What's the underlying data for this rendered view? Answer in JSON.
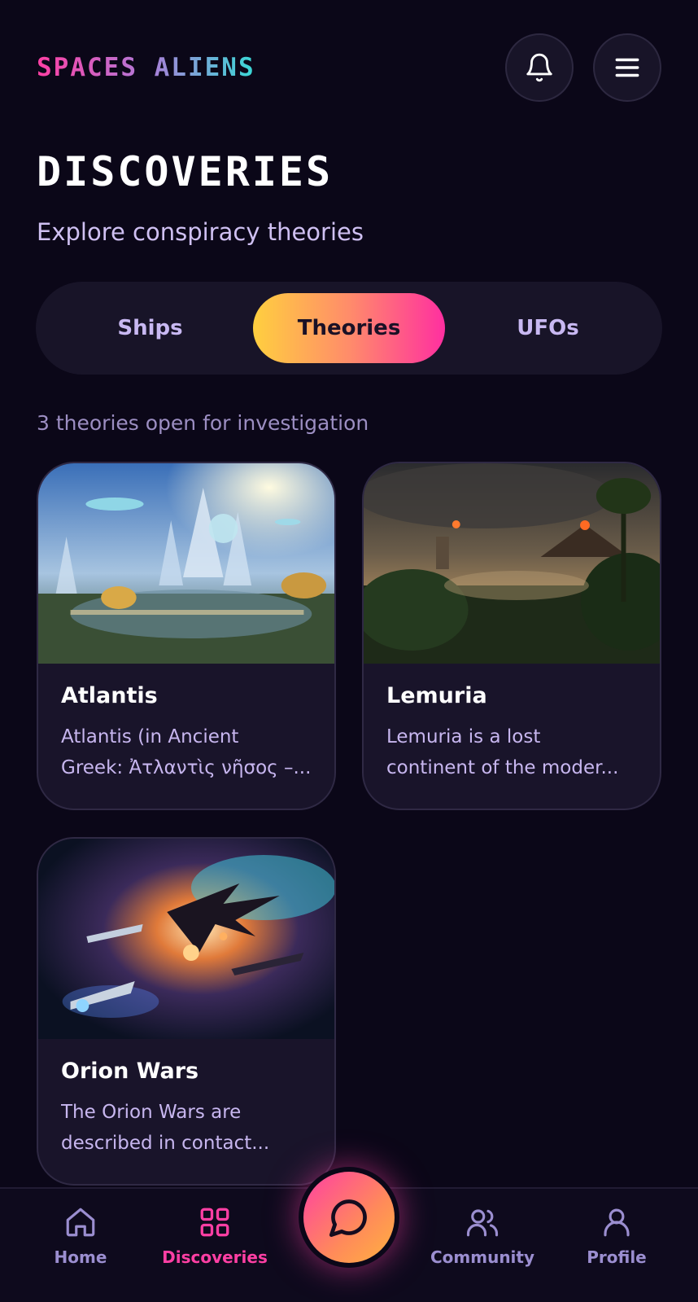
{
  "header": {
    "logo": "SPACES ALIENS",
    "notification_icon": "bell-icon",
    "menu_icon": "hamburger-menu-icon"
  },
  "page": {
    "title": "DISCOVERIES",
    "subtitle": "Explore conspiracy theories"
  },
  "tabs": [
    {
      "label": "Ships",
      "active": false
    },
    {
      "label": "Theories",
      "active": true
    },
    {
      "label": "UFOs",
      "active": false
    }
  ],
  "status": {
    "count_text": "3 theories open for investigation"
  },
  "cards": [
    {
      "title": "Atlantis",
      "desc_line1": "Atlantis (in Ancient",
      "desc_line2": "Greek: Ἀτλαντὶς νῆσος –..."
    },
    {
      "title": "Lemuria",
      "desc_line1": "Lemuria is a lost",
      "desc_line2": "continent of the moder..."
    },
    {
      "title": "Orion Wars",
      "desc_line1": "The Orion Wars are",
      "desc_line2": "described in contact..."
    }
  ],
  "nav": {
    "items": [
      {
        "label": "Home",
        "icon": "home-icon",
        "active": false
      },
      {
        "label": "Discoveries",
        "icon": "grid-icon",
        "active": true
      },
      {
        "label": "Community",
        "icon": "users-icon",
        "active": false
      },
      {
        "label": "Profile",
        "icon": "user-icon",
        "active": false
      }
    ],
    "fab_icon": "chat-bubble-icon"
  },
  "colors": {
    "background": "#0b0718",
    "accent_pink": "#ff3fa4",
    "accent_yellow": "#ffcf3f",
    "accent_cyan": "#38d9d6",
    "text_lavender": "#c8b8f2"
  }
}
